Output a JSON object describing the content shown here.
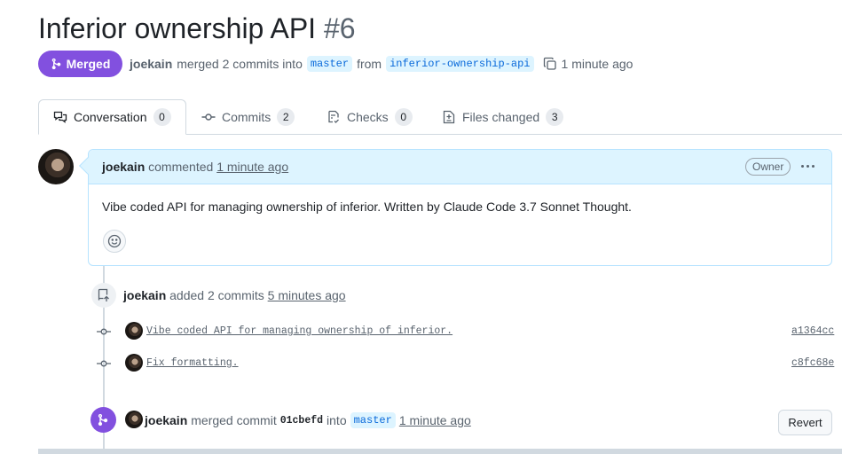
{
  "pr": {
    "title": "Inferior ownership API",
    "number": "#6",
    "status": "Merged",
    "author": "joekain",
    "merge_text": "merged 2 commits into",
    "base_branch": "master",
    "from_text": "from",
    "head_branch": "inferior-ownership-api",
    "time": "1 minute ago"
  },
  "tabs": [
    {
      "label": "Conversation",
      "count": "0",
      "icon": "comment-discussion-icon"
    },
    {
      "label": "Commits",
      "count": "2",
      "icon": "git-commit-icon"
    },
    {
      "label": "Checks",
      "count": "0",
      "icon": "checklist-icon"
    },
    {
      "label": "Files changed",
      "count": "3",
      "icon": "file-diff-icon"
    }
  ],
  "comment": {
    "author": "joekain",
    "action": "commented",
    "time": "1 minute ago",
    "badge": "Owner",
    "body": "Vibe coded API for managing ownership of inferior. Written by Claude Code 3.7 Sonnet Thought."
  },
  "commits_event": {
    "author": "joekain",
    "action": "added 2 commits",
    "time": "5 minutes ago",
    "commits": [
      {
        "message": "Vibe coded API for managing ownership of inferior.",
        "sha": "a1364cc"
      },
      {
        "message": "Fix formatting.",
        "sha": "c8fc68e"
      }
    ]
  },
  "merge_event": {
    "author": "joekain",
    "action": "merged commit",
    "sha": "01cbefd",
    "into": "into",
    "branch": "master",
    "time": "1 minute ago",
    "revert_label": "Revert"
  },
  "colors": {
    "merged": "#8250df",
    "link": "#0969da",
    "comment_header": "#ddf4ff"
  }
}
